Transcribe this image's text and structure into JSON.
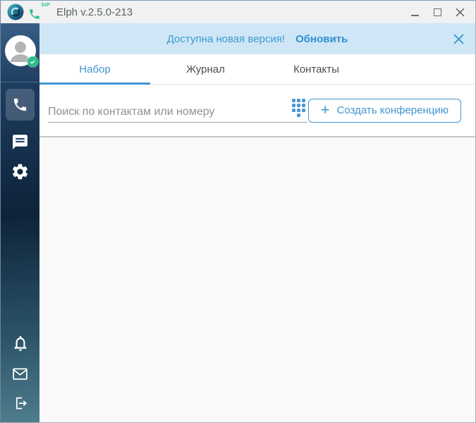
{
  "window": {
    "title": "Elph v.2.5.0-213",
    "logo_sip_label": "SIP"
  },
  "banner": {
    "message": "Доступна новая версия!",
    "action": "Обновить"
  },
  "tabs": [
    {
      "label": "Набор",
      "active": true
    },
    {
      "label": "Журнал",
      "active": false
    },
    {
      "label": "Контакты",
      "active": false
    }
  ],
  "toolbar": {
    "search_placeholder": "Поиск по контактам или номеру",
    "plus": "+",
    "create_conference": "Создать конференцию"
  },
  "sidebar": {
    "avatar": {
      "status": "online"
    },
    "nav": [
      {
        "icon": "phone",
        "active": true
      },
      {
        "icon": "chat",
        "active": false
      },
      {
        "icon": "settings",
        "active": false
      }
    ],
    "bottom": [
      {
        "icon": "bell"
      },
      {
        "icon": "mail"
      },
      {
        "icon": "logout"
      }
    ]
  },
  "icons": {
    "app_logo": "elph-swirl-logo",
    "sip_phone": "green-handset",
    "minimize": "–",
    "maximize": "□",
    "close": "×",
    "banner_close": "×",
    "dialpad": "keypad-dots",
    "avatar_status": "check"
  },
  "colors": {
    "accent": "#3d9ad1",
    "banner_bg": "#cfe6f6",
    "tab_underline": "#4296d2",
    "online_badge": "#2bc089",
    "sip_green": "#2fbf8b",
    "sidebar_top": "#3a5f85",
    "sidebar_mid": "#0e2339",
    "sidebar_bottom": "#4e7d8c",
    "titlebar_bg": "#f1f1f1",
    "content_bg": "#fafafa"
  }
}
